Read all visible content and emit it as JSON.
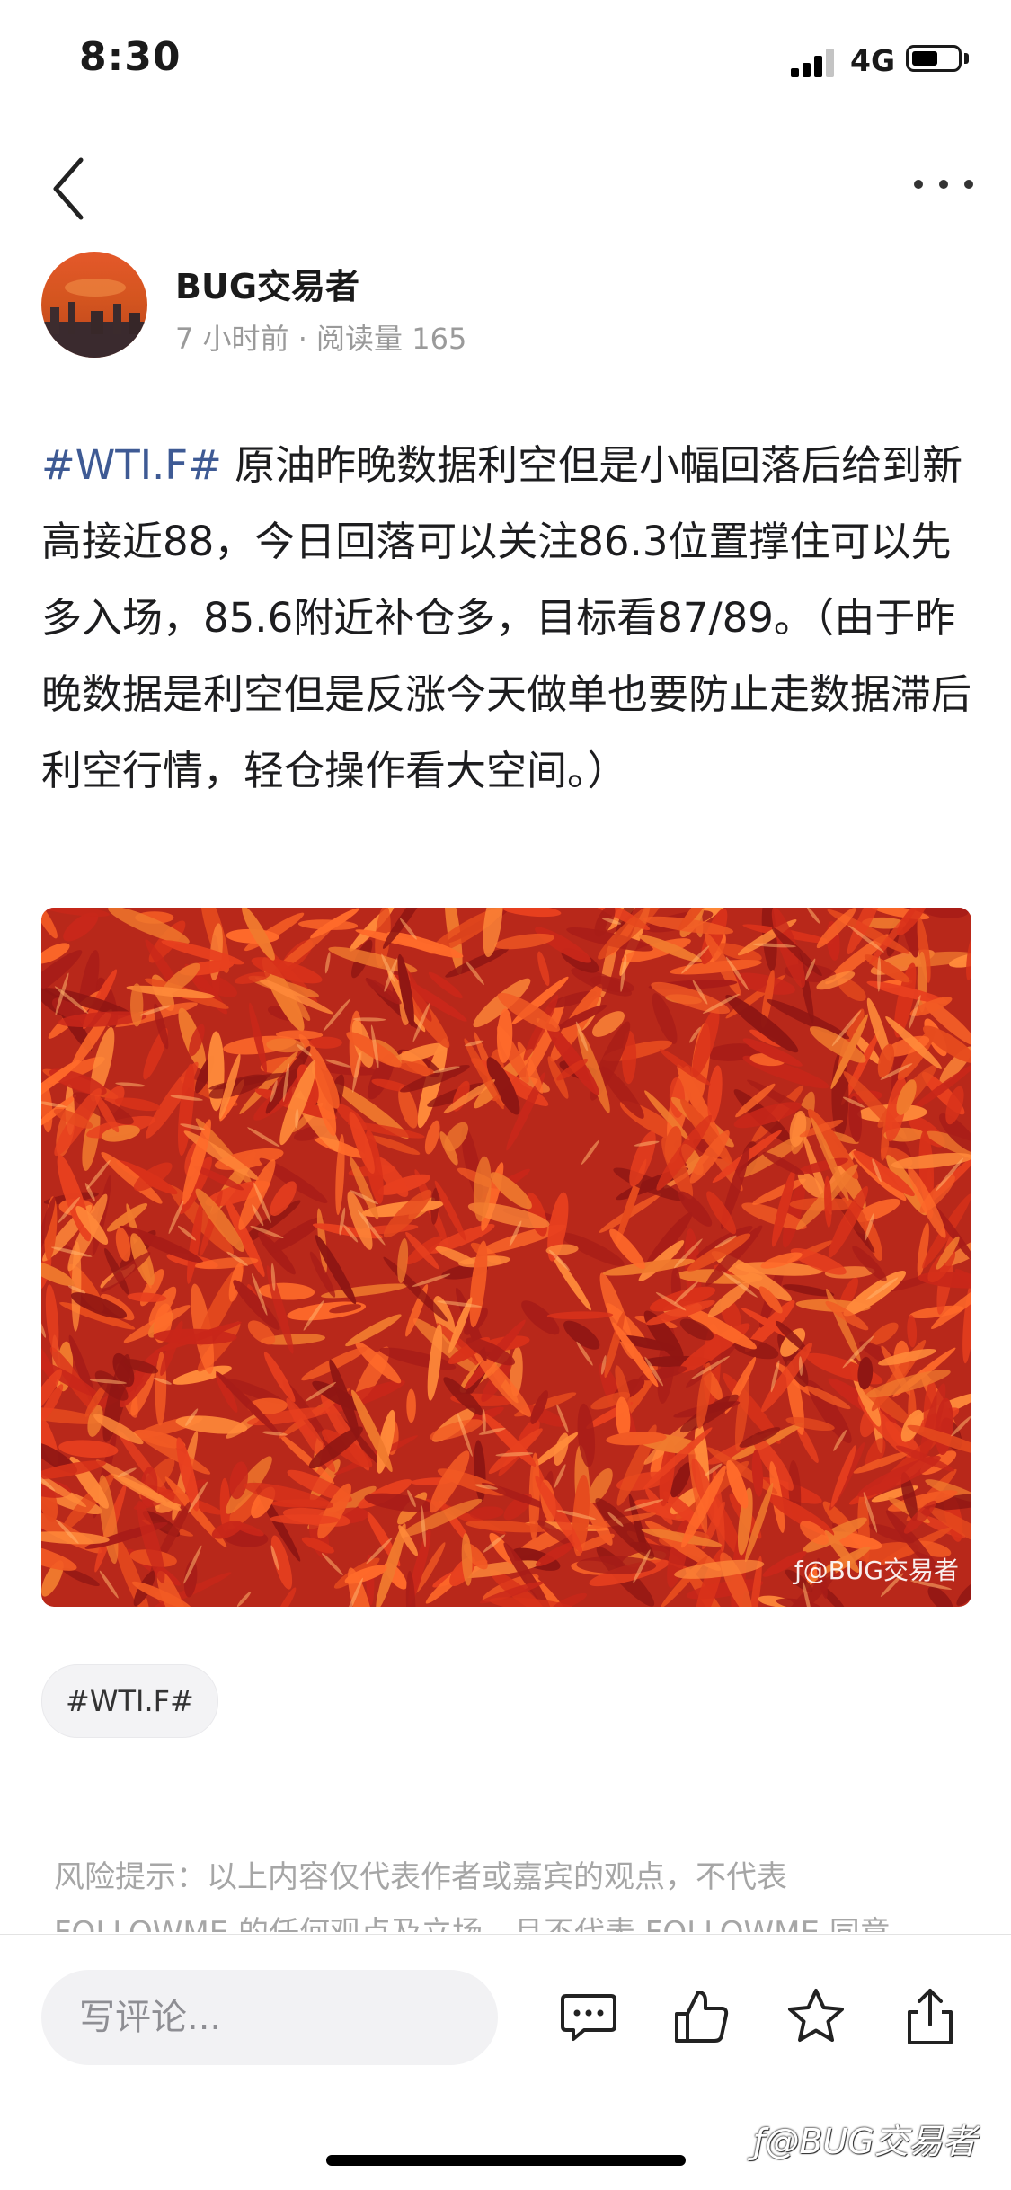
{
  "status_bar": {
    "time": "8:30",
    "network": "4G",
    "battery_level": 0.55
  },
  "nav": {
    "back_icon": "chevron-left-icon",
    "more_icon": "more-horizontal-icon"
  },
  "author": {
    "name": "BUG交易者",
    "meta": "7 小时前 · 阅读量 165"
  },
  "post": {
    "tag": "#WTI.F#",
    "text": " 原油昨晚数据利空但是小幅回落后给到新高接近88，今日回落可以关注86.3位置撑住可以先多入场，85.6附近补仓多，目标看87/89。（由于昨晚数据是利空但是反涨今天做单也要防止走数据滞后利空行情，轻仓操作看大空间。）"
  },
  "image": {
    "watermark": "@BUG交易者"
  },
  "tag_chip": "#WTI.F#",
  "disclaimer": "风险提示：以上内容仅代表作者或嘉宾的观点，不代表 FOLLOWME 的任何观点及立场，且不代表 FOLLOWME 同意",
  "bottom_bar": {
    "comment_placeholder": "写评论...",
    "icons": [
      "comment-icon",
      "like-icon",
      "star-icon",
      "share-icon"
    ]
  },
  "overlay_watermark": "@BUG交易者",
  "colors": {
    "tag": "#3e5a94",
    "meta": "#9a9a9a",
    "disclaimer": "#a6a6a6"
  }
}
